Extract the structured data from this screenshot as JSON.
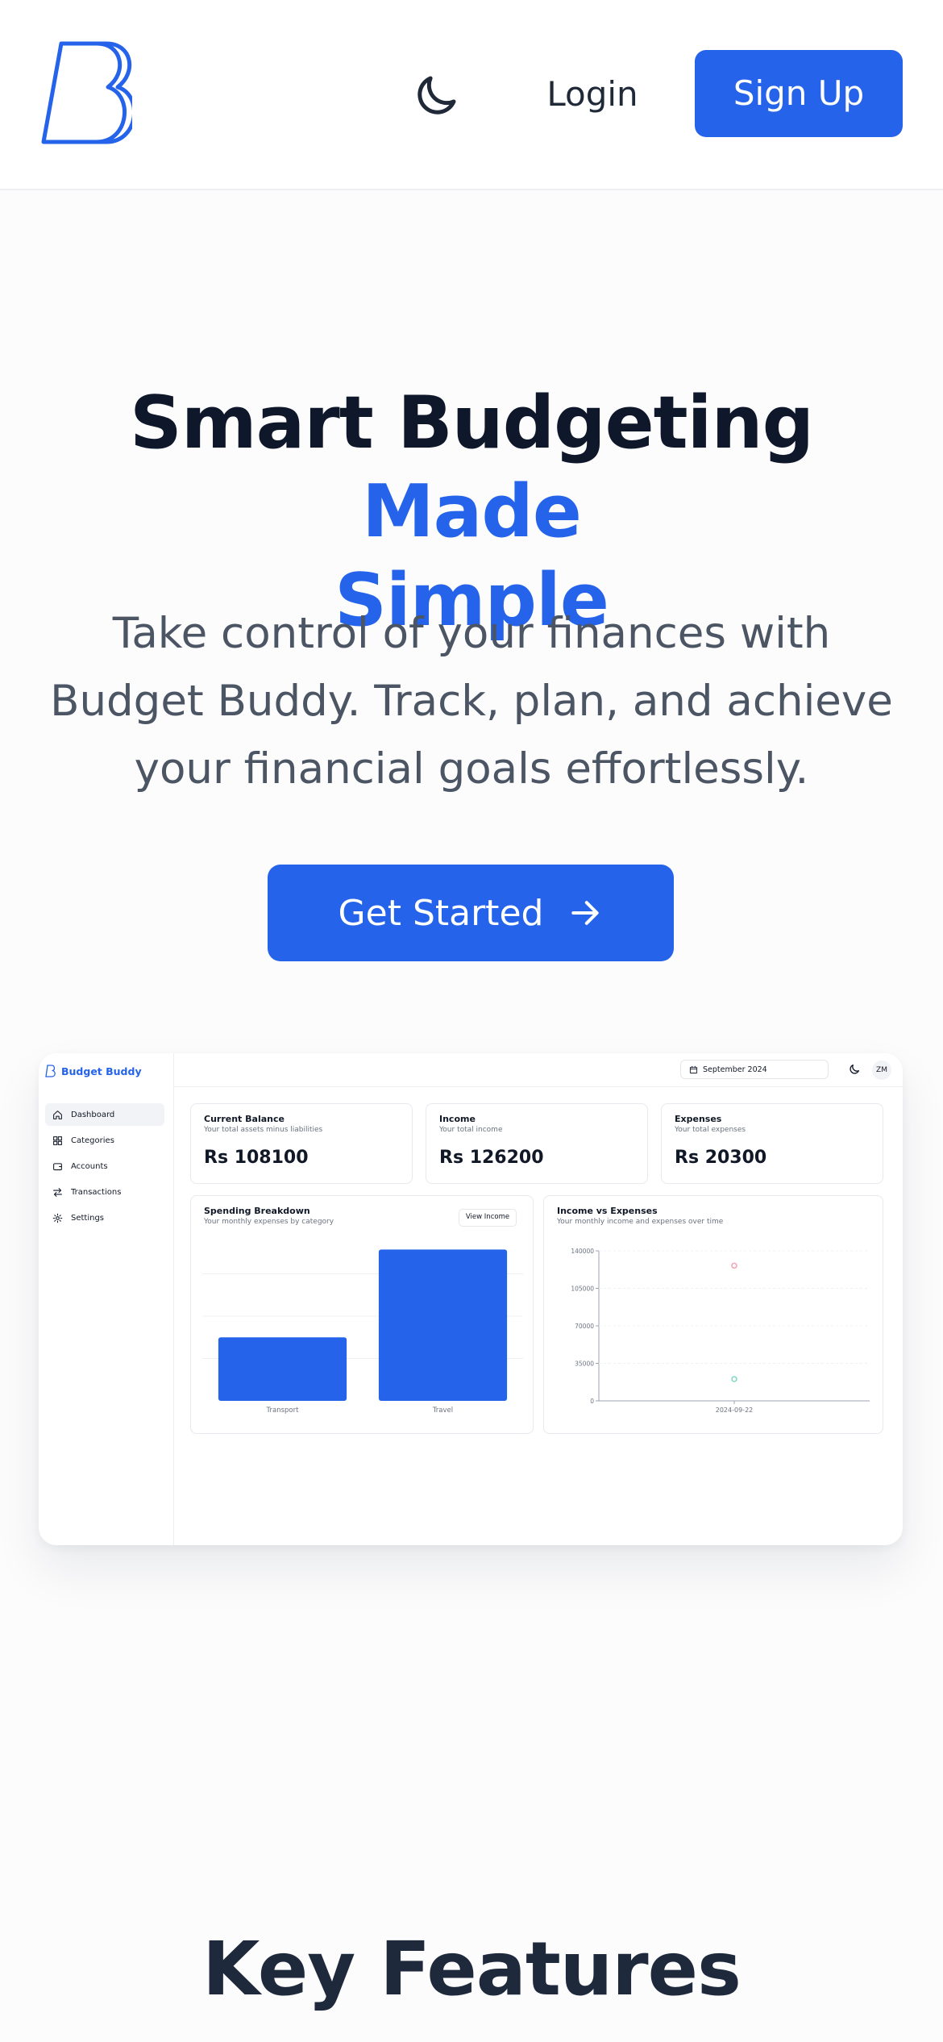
{
  "header": {
    "login_label": "Login",
    "signup_label": "Sign Up",
    "logo_icon": "budget-buddy-logo",
    "theme_icon": "moon-icon"
  },
  "hero": {
    "title_main": "Smart Budgeting ",
    "title_accent_1": "Made",
    "title_accent_2": "Simple",
    "subtitle": "Take control of your finances with Budget Buddy. Track, plan, and achieve your financial goals effortlessly.",
    "cta_label": "Get Started",
    "cta_icon": "arrow-right-icon"
  },
  "preview": {
    "brand": "Budget Buddy",
    "nav": [
      {
        "label": "Dashboard",
        "icon": "home-icon",
        "active": true
      },
      {
        "label": "Categories",
        "icon": "grid-icon",
        "active": false
      },
      {
        "label": "Accounts",
        "icon": "wallet-icon",
        "active": false
      },
      {
        "label": "Transactions",
        "icon": "arrows-icon",
        "active": false
      },
      {
        "label": "Settings",
        "icon": "gear-icon",
        "active": false
      }
    ],
    "date_selector": "September 2024",
    "avatar": "ZM",
    "cards": [
      {
        "title": "Current Balance",
        "subtitle": "Your total assets minus liabilities",
        "value": "Rs 108100"
      },
      {
        "title": "Income",
        "subtitle": "Your total income",
        "value": "Rs 126200"
      },
      {
        "title": "Expenses",
        "subtitle": "Your total expenses",
        "value": "Rs 20300"
      }
    ],
    "spending": {
      "title": "Spending Breakdown",
      "subtitle": "Your monthly expenses by category",
      "view_button": "View Income"
    },
    "income_expenses": {
      "title": "Income vs Expenses",
      "subtitle": "Your monthly income and expenses over time"
    }
  },
  "chart_data": [
    {
      "type": "bar",
      "categories": [
        "Transport",
        "Travel"
      ],
      "values": [
        6000,
        14300
      ],
      "ylim": [
        0,
        16000
      ],
      "grid": true,
      "bar_color": "#2563eb"
    },
    {
      "type": "scatter",
      "x": [
        "2024-09-22"
      ],
      "series": [
        {
          "values": [
            126200
          ],
          "color": "#f4a3b4"
        },
        {
          "values": [
            20300
          ],
          "color": "#7fd6c2"
        }
      ],
      "yticks": [
        "0",
        "35000",
        "70000",
        "105000",
        "140000"
      ],
      "ylim": [
        0,
        140000
      ],
      "grid": true
    }
  ],
  "features": {
    "title": "Key Features"
  },
  "colors": {
    "primary": "#2563eb",
    "heading": "#0f172a",
    "body": "#4b5563"
  }
}
